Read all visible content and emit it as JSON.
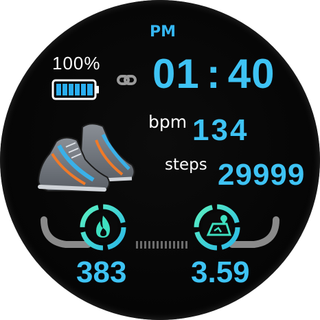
{
  "time": {
    "ampm": "PM",
    "hours": "01",
    "separator": ":",
    "minutes": "40"
  },
  "battery": {
    "percent_label": "100%",
    "level": 1.0
  },
  "heart_rate": {
    "label": "bpm",
    "value": "134"
  },
  "steps": {
    "label": "steps",
    "value": "29999"
  },
  "calories": {
    "value": "383",
    "icon": "flame-icon"
  },
  "distance": {
    "value": "3.59",
    "icon": "route-map-icon"
  },
  "icons": {
    "link": "link-icon",
    "shoes": "sneakers-icon"
  },
  "colors": {
    "accent_blue": "#3ec3f4",
    "accent_green": "#3ee0a8",
    "battery_cyan": "#2aaef0",
    "background": "#000000"
  }
}
